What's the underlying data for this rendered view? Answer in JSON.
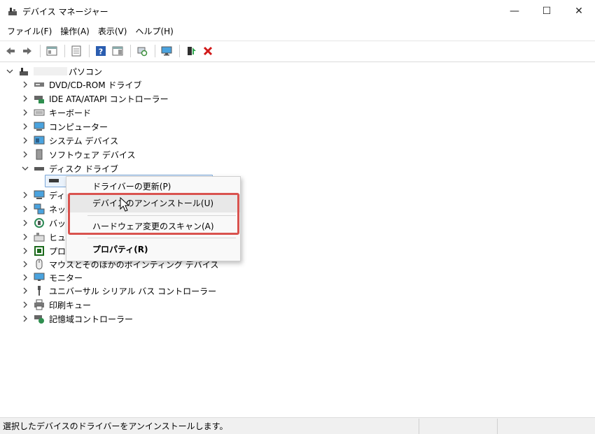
{
  "window": {
    "title": "デバイス マネージャー",
    "minimize_glyph": "—",
    "maximize_glyph": "☐",
    "close_glyph": "✕"
  },
  "menu": [
    "ファイル(F)",
    "操作(A)",
    "表示(V)",
    "ヘルプ(H)"
  ],
  "toolbar": {
    "buttons": [
      "back-arrow-icon",
      "forward-arrow-icon",
      "show-hide-console-tree-icon",
      "properties-icon",
      "help-icon",
      "action-pane-icon",
      "scan-hardware-icon",
      "monitor-icon",
      "update-driver-icon",
      "uninstall-device-icon"
    ]
  },
  "tree": {
    "root_label": "パソコン",
    "categories": [
      {
        "label": "DVD/CD-ROM ドライブ",
        "icon": "dvd-drive-icon",
        "expanded": false
      },
      {
        "label": "IDE ATA/ATAPI コントローラー",
        "icon": "ide-controller-icon",
        "expanded": false
      },
      {
        "label": "キーボード",
        "icon": "keyboard-icon",
        "expanded": false
      },
      {
        "label": "コンピューター",
        "icon": "computer-icon",
        "expanded": false
      },
      {
        "label": "システム デバイス",
        "icon": "system-devices-icon",
        "expanded": false
      },
      {
        "label": "ソフトウェア デバイス",
        "icon": "software-devices-icon",
        "expanded": false
      },
      {
        "label": "ディスク ドライブ",
        "icon": "disk-drive-icon",
        "expanded": true
      },
      {
        "label": "ディ",
        "icon": "display-adapter-icon",
        "expanded": false
      },
      {
        "label": "ネッ",
        "icon": "network-adapter-icon",
        "expanded": false
      },
      {
        "label": "バッ",
        "icon": "battery-icon",
        "expanded": false
      },
      {
        "label": "ヒュ",
        "icon": "hid-icon",
        "expanded": false
      },
      {
        "label": "プロ",
        "icon": "processor-icon",
        "expanded": false
      },
      {
        "label": "マウスとそのほかのポインティング デバイス",
        "icon": "mouse-icon",
        "expanded": false
      },
      {
        "label": "モニター",
        "icon": "monitor-icon",
        "expanded": false
      },
      {
        "label": "ユニバーサル シリアル バス コントローラー",
        "icon": "usb-icon",
        "expanded": false
      },
      {
        "label": "印刷キュー",
        "icon": "printer-icon",
        "expanded": false
      },
      {
        "label": "記憶域コントローラー",
        "icon": "storage-controller-icon",
        "expanded": false
      }
    ]
  },
  "context_menu": {
    "items": [
      {
        "label": "ドライバーの更新(P)"
      },
      {
        "label": "デバイスのアンインストール(U)"
      },
      {
        "label": "ハードウェア変更のスキャン(A)"
      },
      {
        "label": "プロパティ(R)"
      }
    ]
  },
  "status": {
    "text": "選択したデバイスのドライバーをアンインストールします。"
  },
  "colors": {
    "highlight": "#d9534f",
    "selection": "#7aa7d9",
    "accent": "#1e74c5"
  }
}
